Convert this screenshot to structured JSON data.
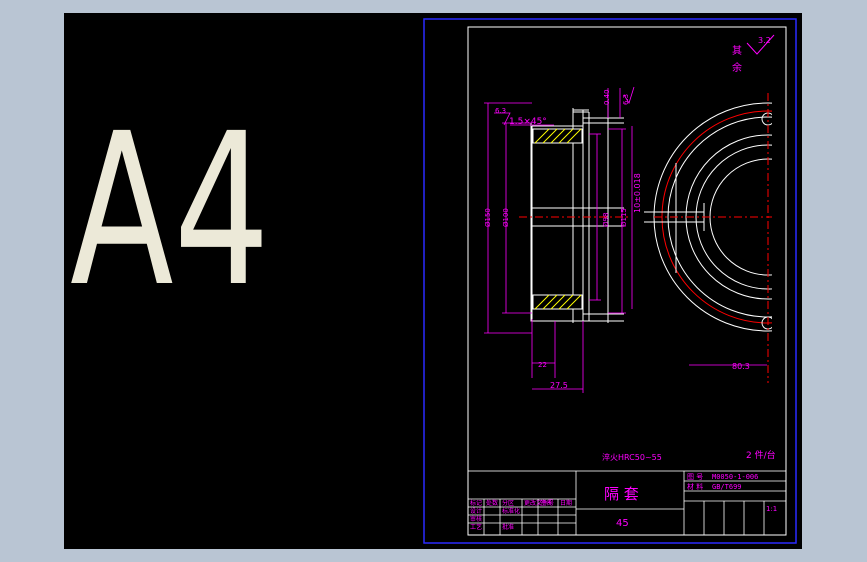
{
  "canvas": {
    "background": "#000000",
    "frame_color": "#b9c5d3"
  },
  "colors": {
    "border": "#2a2aff",
    "lines": "#ffffff",
    "dims": "#ff00ff",
    "center": "#ff0000",
    "hatch": "#ffff00",
    "a4": "#ece9d8"
  },
  "sheet_label": "A4",
  "dimensions": {
    "chamfer_note": "1.5×45°",
    "surface_left": "6.3",
    "surface_top": "6.3",
    "slot_top": "0.40",
    "dia_150": "Ø150",
    "dia_100": "Ø100",
    "dia_98": "Ø98",
    "dia_115": "Ø115",
    "tol_02": "10±0.018",
    "len_22": "22",
    "len_275": "27.5",
    "len_803": "80.3"
  },
  "notes": {
    "other_label_1": "其",
    "other_label_2": "余",
    "other_roughness": "3.2",
    "heat_treat": "淬火HRC50~55",
    "qty": "2 件/台"
  },
  "title_block": {
    "part_name": "隔 套",
    "drawing_no": "M0050-1-006",
    "material_code": "45",
    "label_tuhao": "图 号",
    "label_cailiao": "材 料",
    "material_label_val": "GB/T699",
    "scale": "1:1",
    "r1": [
      "标记",
      "处数",
      "分区",
      "更改文件号",
      "签名",
      "日期"
    ],
    "r2": [
      "设计",
      "",
      "标准化",
      ""
    ],
    "r3": [
      "审核",
      "",
      "",
      ""
    ],
    "r4": [
      "工艺",
      "",
      "批准",
      ""
    ]
  }
}
